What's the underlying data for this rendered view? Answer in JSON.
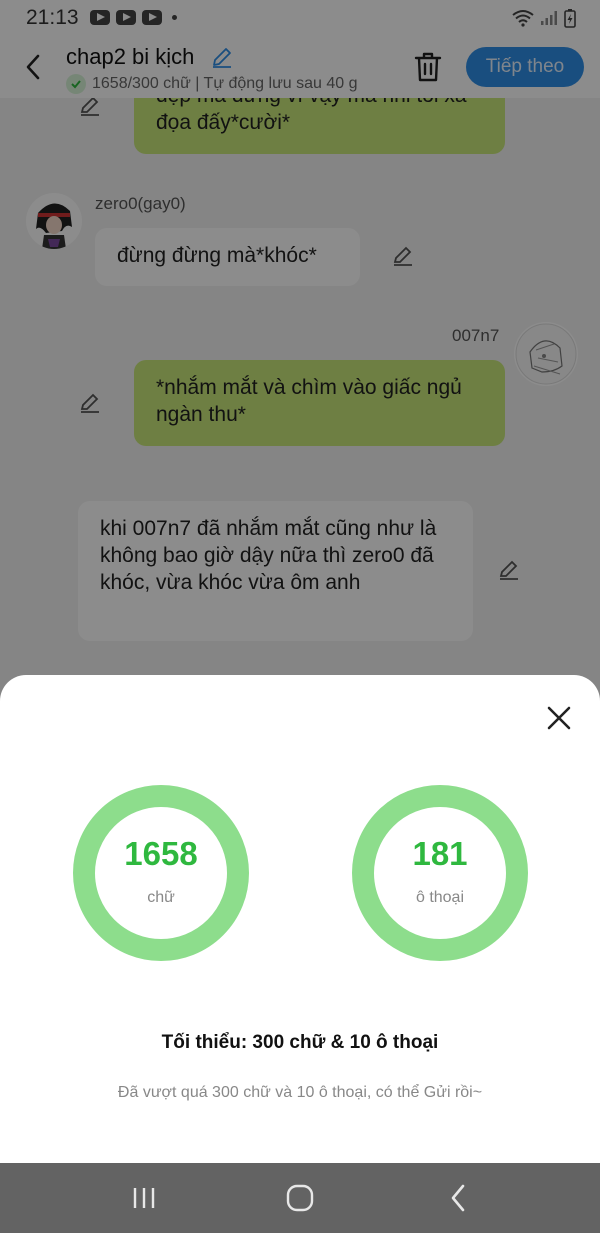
{
  "status_bar": {
    "time": "21:13"
  },
  "header": {
    "title": "chap2 bi kịch",
    "save_status": "1658/300 chữ | Tự động lưu sau 40 g",
    "next_label": "Tiếp theo"
  },
  "chat": {
    "messages": [
      {
        "speaker": "",
        "side": "right",
        "text": "đẹp mà đừng vì vậy mà nhỉ tôi xa đọa đấy*cười*"
      },
      {
        "speaker": "zero0(gay0)",
        "side": "left",
        "text": "đừng đừng mà*khóc*"
      },
      {
        "speaker": "007n7",
        "side": "right",
        "text": "*nhắm mắt và chìm vào giấc ngủ ngàn thu*"
      },
      {
        "speaker": "",
        "side": "narration",
        "text": "khi 007n7 đã nhắm mắt cũng như là không bao giờ dậy nữa thì zero0 đã khóc, vừa khóc vừa ôm anh"
      }
    ]
  },
  "stats_sheet": {
    "words_count": "1658",
    "words_label": "chữ",
    "dialog_count": "181",
    "dialog_label": "ô thoại",
    "minimum_text": "Tối thiểu: 300 chữ & 10 ô thoại",
    "status_text": "Đã vượt quá 300 chữ và 10 ô thoại, có thể Gửi rồi~"
  },
  "colors": {
    "ring": "#8ddd8c",
    "count_text": "#2fb83f",
    "next_button": "#2f8fe8",
    "bubble_right": "#c8e87a"
  }
}
